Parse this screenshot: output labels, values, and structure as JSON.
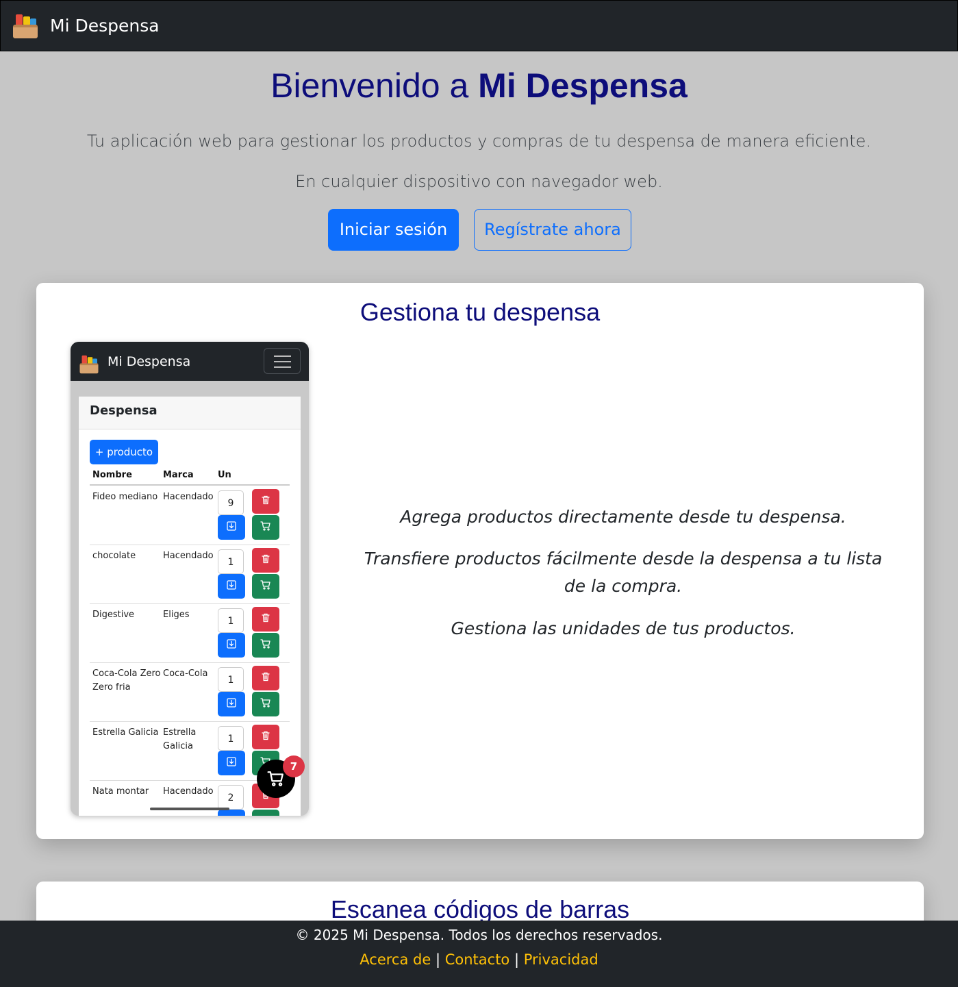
{
  "navbar": {
    "brand": "Mi Despensa",
    "logo_icon": "pantry-logo-icon"
  },
  "hero": {
    "title_prefix": "Bienvenido a ",
    "title_bold": "Mi Despensa",
    "lead1": "Tu aplicación web para gestionar los productos y compras de tu despensa de manera eficiente.",
    "lead2": "En cualquier dispositivo con navegador web.",
    "login_label": "Iniciar sesión",
    "register_label": "Regístrate ahora"
  },
  "feature1": {
    "title": "Gestiona tu despensa",
    "texts": [
      "Agrega productos directamente desde tu despensa.",
      "Transfiere productos fácilmente desde la despensa a tu lista de la compra.",
      "Gestiona las unidades de tus productos."
    ],
    "phone": {
      "brand": "Mi Despensa",
      "panel_title": "Despensa",
      "add_label": "+ producto",
      "headers": [
        "Nombre",
        "Marca",
        "Un"
      ],
      "rows": [
        {
          "name": "Fideo mediano",
          "brand": "Hacendado",
          "qty": "9"
        },
        {
          "name": "chocolate",
          "brand": "Hacendado",
          "qty": "1"
        },
        {
          "name": "Digestive",
          "brand": "Eliges",
          "qty": "1"
        },
        {
          "name": "Coca-Cola Zero Zero fria",
          "brand": "Coca-Cola",
          "qty": "1"
        },
        {
          "name": "Estrella Galicia",
          "brand": "Estrella Galicia",
          "qty": "1"
        },
        {
          "name": "Nata montar",
          "brand": "Hacendado",
          "qty": "2"
        }
      ],
      "cart_count": "7"
    }
  },
  "feature2": {
    "title": "Escanea códigos de barras"
  },
  "footer": {
    "copyright": "© 2025 Mi Despensa. Todos los derechos reservados.",
    "links": [
      "Acerca de",
      "Contacto",
      "Privacidad"
    ],
    "separator": " | "
  },
  "colors": {
    "navbar_bg": "#212529",
    "page_bg": "#c6c6c6",
    "title": "#0d0d7a",
    "primary": "#0d6efd",
    "danger": "#dc3545",
    "success": "#198754",
    "link": "#ffc107"
  }
}
